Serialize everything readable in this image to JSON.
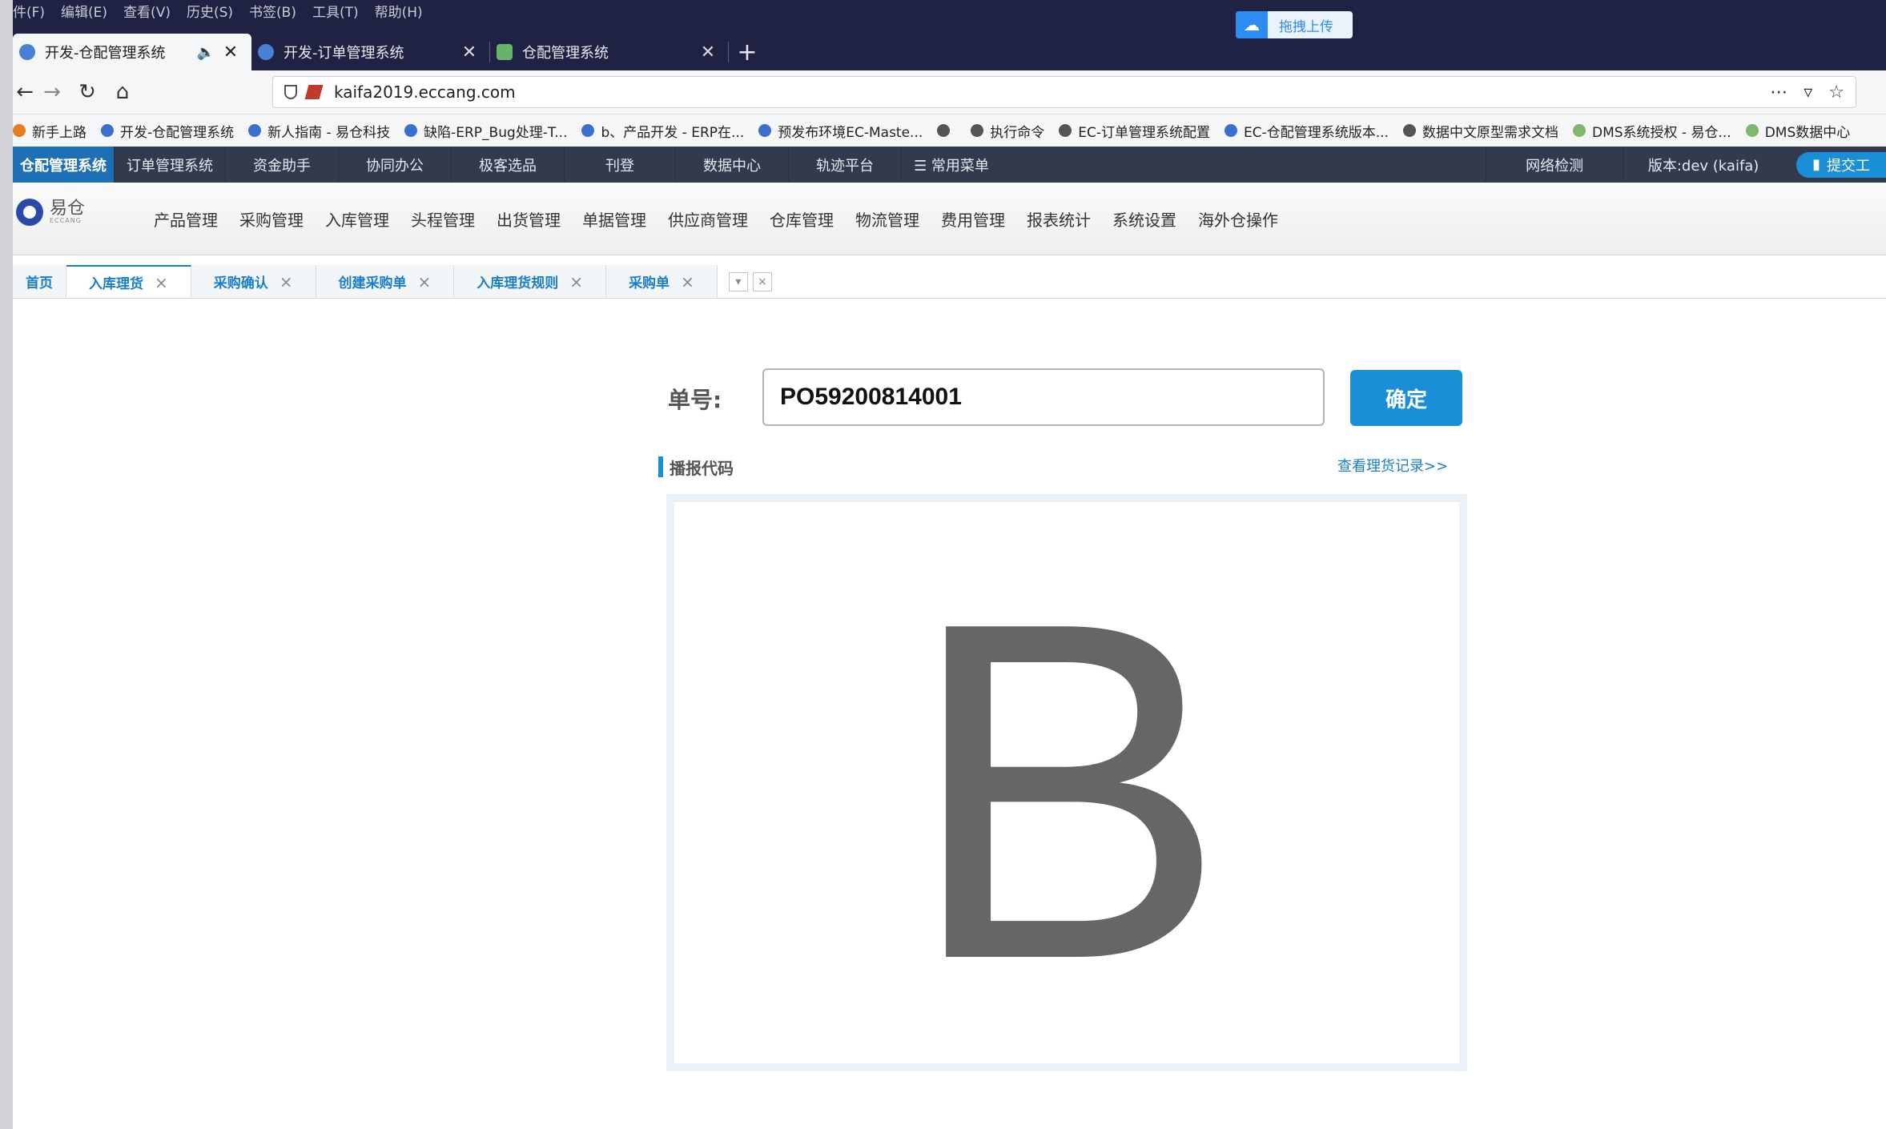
{
  "browser": {
    "menu": [
      "件(F)",
      "编辑(E)",
      "查看(V)",
      "历史(S)",
      "书签(B)",
      "工具(T)",
      "帮助(H)"
    ],
    "upload_label": "拖拽上传",
    "tabs": [
      {
        "title": "开发-仓配管理系统"
      },
      {
        "title": "开发-订单管理系统"
      },
      {
        "title": "仓配管理系统"
      }
    ],
    "url": "kaifa2019.eccang.com",
    "bookmarks": [
      "新手上路",
      "开发-仓配管理系统",
      "新人指南 - 易仓科技",
      "缺陷-ERP_Bug处理-T...",
      "b、产品开发 - ERP在...",
      "预发布环境EC-Maste...",
      "",
      "执行命令",
      "EC-订单管理系统配置",
      "EC-仓配管理系统版本...",
      "数据中文原型需求文档",
      "DMS系统授权 - 易仓...",
      "DMS数据中心"
    ]
  },
  "app": {
    "top_nav": [
      "仓配管理系统",
      "订单管理系统",
      "资金助手",
      "协同办公",
      "极客选品",
      "刊登",
      "数据中心",
      "轨迹平台",
      "☰ 常用菜单"
    ],
    "top_right": [
      "网络检测",
      "版本:dev (kaifa)"
    ],
    "submit_label": "提交工",
    "logo": {
      "cn": "易仓",
      "en": "ECCANG"
    },
    "modules": [
      "产品管理",
      "采购管理",
      "入库管理",
      "头程管理",
      "出货管理",
      "单据管理",
      "供应商管理",
      "仓库管理",
      "物流管理",
      "费用管理",
      "报表统计",
      "系统设置",
      "海外仓操作"
    ],
    "page_tabs": [
      {
        "label": "首页",
        "closable": false
      },
      {
        "label": "入库理货",
        "closable": true
      },
      {
        "label": "采购确认",
        "closable": true
      },
      {
        "label": "创建采购单",
        "closable": true
      },
      {
        "label": "入库理货规则",
        "closable": true
      },
      {
        "label": "采购单",
        "closable": true
      }
    ]
  },
  "main": {
    "order_label": "单号:",
    "order_value": "PO59200814001",
    "confirm_label": "确定",
    "section_title": "播报代码",
    "history_link": "查看理货记录>>",
    "broadcast_code": "B"
  },
  "colors": {
    "accent": "#1a8fd8",
    "app_nav_bg": "#313b4d",
    "browser_bg": "#1f2242",
    "code_letter": "#666666"
  }
}
